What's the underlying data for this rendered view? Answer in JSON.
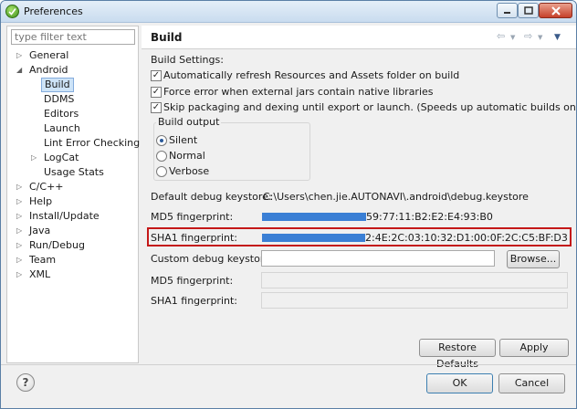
{
  "window": {
    "title": "Preferences"
  },
  "filter": {
    "placeholder": "type filter text"
  },
  "tree": [
    {
      "label": "General",
      "arrow": "▷"
    },
    {
      "label": "Android",
      "arrow": "◢"
    },
    {
      "label": "Build",
      "arrow": ""
    },
    {
      "label": "DDMS",
      "arrow": ""
    },
    {
      "label": "Editors",
      "arrow": ""
    },
    {
      "label": "Launch",
      "arrow": ""
    },
    {
      "label": "Lint Error Checking",
      "arrow": ""
    },
    {
      "label": "LogCat",
      "arrow": "▷"
    },
    {
      "label": "Usage Stats",
      "arrow": ""
    },
    {
      "label": "C/C++",
      "arrow": "▷"
    },
    {
      "label": "Help",
      "arrow": "▷"
    },
    {
      "label": "Install/Update",
      "arrow": "▷"
    },
    {
      "label": "Java",
      "arrow": "▷"
    },
    {
      "label": "Run/Debug",
      "arrow": "▷"
    },
    {
      "label": "Team",
      "arrow": "▷"
    },
    {
      "label": "XML",
      "arrow": "▷"
    }
  ],
  "page": {
    "title": "Build"
  },
  "settings": {
    "section_label": "Build Settings:",
    "auto_refresh": {
      "label": "Automatically refresh Resources and Assets folder on build",
      "checked": true
    },
    "force_error": {
      "label": "Force error when external jars contain native libraries",
      "checked": true
    },
    "skip_packaging": {
      "label": "Skip packaging and dexing until export or launch. (Speeds up automatic builds on file save)",
      "checked": true
    }
  },
  "build_output": {
    "legend": "Build output",
    "options": [
      "Silent",
      "Normal",
      "Verbose"
    ],
    "selected": "Silent"
  },
  "fields": {
    "default_keystore_label": "Default debug keystore:",
    "default_keystore_value": "C:\\Users\\chen.jie.AUTONAVI\\.android\\debug.keystore",
    "md5_label": "MD5 fingerprint:",
    "md5_value": "59:77:11:B2:E2:E4:93:B0",
    "sha1_label": "SHA1 fingerprint:",
    "sha1_value": "2:4E:2C:03:10:32:D1:00:0F:2C:C5:BF:D3",
    "custom_keystore_label": "Custom debug keystore:",
    "custom_md5_label": "MD5 fingerprint:",
    "custom_sha1_label": "SHA1 fingerprint:"
  },
  "buttons": {
    "browse": "Browse...",
    "restore_defaults": "Restore Defaults",
    "apply": "Apply",
    "ok": "OK",
    "cancel": "Cancel",
    "help": "?"
  },
  "colors": {
    "redaction": "#3a7fd5",
    "highlight": "#c41818",
    "selection": "#cde3f7"
  }
}
